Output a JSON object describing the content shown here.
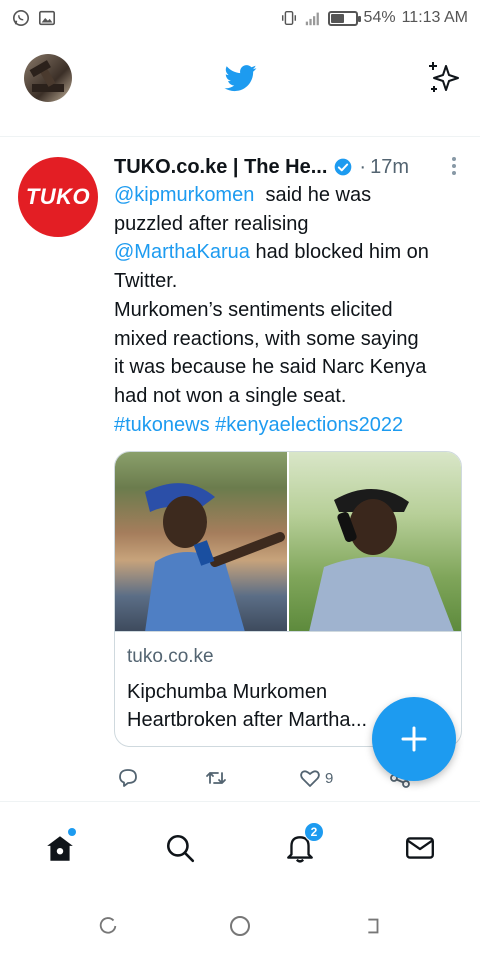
{
  "status_bar": {
    "battery_percent": "54%",
    "time": "11:13 AM",
    "battery_level": 0.54
  },
  "header": {
    "icons": [
      "profile-avatar",
      "twitter-bird-icon",
      "sparkle-icon"
    ]
  },
  "tweet": {
    "author_avatar_text": "TUKO",
    "author_name": "TUKO.co.ke | The He...",
    "separator": "·",
    "time": "17m",
    "lines": [
      {
        "mention": "@kipmurkomen",
        "text": "  said he was"
      },
      {
        "text": "puzzled after realising"
      },
      {
        "mention": "@MarthaKarua",
        "text": " had blocked him on"
      },
      {
        "text": "Twitter."
      },
      {
        "text": "Murkomen’s sentiments elicited"
      },
      {
        "text": "mixed reactions, with some saying"
      },
      {
        "text": "it was because he said Narc Kenya"
      },
      {
        "text": "had not won a single seat."
      }
    ],
    "hashtags": "#tukonews #kenyaelections2022",
    "card": {
      "domain": "tuko.co.ke",
      "title_line1": "Kipchumba Murkomen",
      "title_line2": "Heartbroken after Martha..."
    },
    "actions": {
      "reply_count": "",
      "retweet_count": "",
      "like_count": "9"
    }
  },
  "bottom_nav": {
    "notifications_badge": "2",
    "items": [
      "home",
      "search",
      "notifications",
      "messages"
    ]
  },
  "colors": {
    "accent": "#1d9bf0",
    "tuko_red": "#e31e24",
    "text": "#0f1419",
    "secondary": "#536471"
  }
}
